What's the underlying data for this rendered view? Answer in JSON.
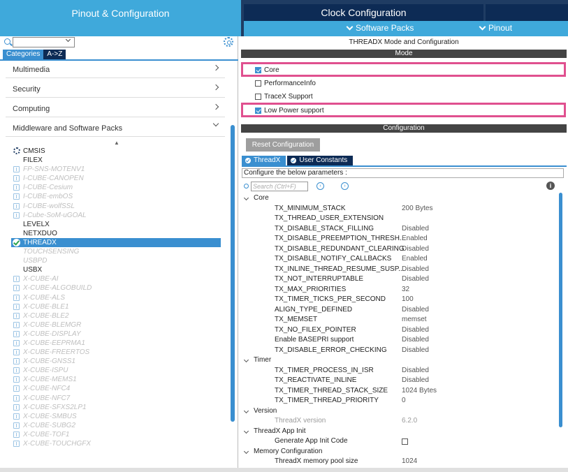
{
  "top_tabs": {
    "pinout_config": "Pinout & Configuration",
    "clock_config": "Clock Configuration"
  },
  "subnav": {
    "software_packs": "Software Packs",
    "pinout": "Pinout"
  },
  "left": {
    "search_value": "",
    "tabs": [
      "Categories",
      "A->Z"
    ],
    "categories": [
      "Multimedia",
      "Security",
      "Computing",
      "Middleware and Software Packs"
    ],
    "items": [
      {
        "label": "CMSIS",
        "state": "normal",
        "icon": "gear-icon"
      },
      {
        "label": "FILEX",
        "state": "normal",
        "icon": ""
      },
      {
        "label": "FP-SNS-MOTENV1",
        "state": "disabled",
        "icon": "package-icon"
      },
      {
        "label": "I-CUBE-CANOPEN",
        "state": "disabled",
        "icon": "package-icon"
      },
      {
        "label": "I-CUBE-Cesium",
        "state": "disabled",
        "icon": "package-icon"
      },
      {
        "label": "I-CUBE-embOS",
        "state": "disabled",
        "icon": "package-icon"
      },
      {
        "label": "I-CUBE-wolfSSL",
        "state": "disabled",
        "icon": "package-icon"
      },
      {
        "label": "I-Cube-SoM-uGOAL",
        "state": "disabled",
        "icon": "package-icon"
      },
      {
        "label": "LEVELX",
        "state": "normal",
        "icon": ""
      },
      {
        "label": "NETXDUO",
        "state": "normal",
        "icon": ""
      },
      {
        "label": "THREADX",
        "state": "selected",
        "icon": "check-circle-icon"
      },
      {
        "label": "TOUCHSENSING",
        "state": "disabled",
        "icon": ""
      },
      {
        "label": "USBPD",
        "state": "disabled",
        "icon": ""
      },
      {
        "label": "USBX",
        "state": "normal",
        "icon": ""
      },
      {
        "label": "X-CUBE-AI",
        "state": "disabled",
        "icon": "package-icon"
      },
      {
        "label": "X-CUBE-ALGOBUILD",
        "state": "disabled",
        "icon": "package-icon"
      },
      {
        "label": "X-CUBE-ALS",
        "state": "disabled",
        "icon": "package-icon"
      },
      {
        "label": "X-CUBE-BLE1",
        "state": "disabled",
        "icon": "package-icon"
      },
      {
        "label": "X-CUBE-BLE2",
        "state": "disabled",
        "icon": "package-icon"
      },
      {
        "label": "X-CUBE-BLEMGR",
        "state": "disabled",
        "icon": "package-icon"
      },
      {
        "label": "X-CUBE-DISPLAY",
        "state": "disabled",
        "icon": "package-icon"
      },
      {
        "label": "X-CUBE-EEPRMA1",
        "state": "disabled",
        "icon": "package-icon"
      },
      {
        "label": "X-CUBE-FREERTOS",
        "state": "disabled",
        "icon": "package-icon"
      },
      {
        "label": "X-CUBE-GNSS1",
        "state": "disabled",
        "icon": "package-icon"
      },
      {
        "label": "X-CUBE-ISPU",
        "state": "disabled",
        "icon": "package-icon"
      },
      {
        "label": "X-CUBE-MEMS1",
        "state": "disabled",
        "icon": "package-icon"
      },
      {
        "label": "X-CUBE-NFC4",
        "state": "disabled",
        "icon": "package-icon"
      },
      {
        "label": "X-CUBE-NFC7",
        "state": "disabled",
        "icon": "package-icon"
      },
      {
        "label": "X-CUBE-SFXS2LP1",
        "state": "disabled",
        "icon": "package-icon"
      },
      {
        "label": "X-CUBE-SMBUS",
        "state": "disabled",
        "icon": "package-icon"
      },
      {
        "label": "X-CUBE-SUBG2",
        "state": "disabled",
        "icon": "package-icon"
      },
      {
        "label": "X-CUBE-TOF1",
        "state": "disabled",
        "icon": "package-icon"
      },
      {
        "label": "X-CUBE-TOUCHGFX",
        "state": "disabled",
        "icon": "package-icon"
      }
    ]
  },
  "right": {
    "title": "THREADX Mode and Configuration",
    "mode_header": "Mode",
    "mode_options": [
      {
        "label": "Core",
        "checked": true,
        "highlighted": true
      },
      {
        "label": "PerformanceInfo",
        "checked": false,
        "highlighted": false
      },
      {
        "label": "TraceX Support",
        "checked": false,
        "highlighted": false
      },
      {
        "label": "Low Power support",
        "checked": true,
        "highlighted": true
      }
    ],
    "config_header": "Configuration",
    "reset_button": "Reset Configuration",
    "config_tabs": [
      "ThreadX",
      "User Constants"
    ],
    "param_caption": "Configure the below parameters :",
    "search_placeholder": "Search (Ctrl+F)",
    "tree": [
      {
        "type": "group",
        "label": "Core"
      },
      {
        "type": "param",
        "label": "TX_MINIMUM_STACK",
        "value": "200 Bytes"
      },
      {
        "type": "param",
        "label": "TX_THREAD_USER_EXTENSION",
        "value": ""
      },
      {
        "type": "param",
        "label": "TX_DISABLE_STACK_FILLING",
        "value": "Disabled"
      },
      {
        "type": "param",
        "label": "TX_DISABLE_PREEMPTION_THRESH...",
        "value": "Enabled"
      },
      {
        "type": "param",
        "label": "TX_DISABLE_REDUNDANT_CLEARING",
        "value": "Disabled"
      },
      {
        "type": "param",
        "label": "TX_DISABLE_NOTIFY_CALLBACKS",
        "value": "Enabled"
      },
      {
        "type": "param",
        "label": "TX_INLINE_THREAD_RESUME_SUSP...",
        "value": "Disabled"
      },
      {
        "type": "param",
        "label": "TX_NOT_INTERRUPTABLE",
        "value": "Disabled"
      },
      {
        "type": "param",
        "label": "TX_MAX_PRIORITIES",
        "value": "32"
      },
      {
        "type": "param",
        "label": "TX_TIMER_TICKS_PER_SECOND",
        "value": "100"
      },
      {
        "type": "param",
        "label": "ALIGN_TYPE_DEFINED",
        "value": "Disabled"
      },
      {
        "type": "param",
        "label": "TX_MEMSET",
        "value": "memset"
      },
      {
        "type": "param",
        "label": "TX_NO_FILEX_POINTER",
        "value": "Disabled"
      },
      {
        "type": "param",
        "label": "Enable BASEPRI support",
        "value": "Disabled"
      },
      {
        "type": "param",
        "label": "TX_DISABLE_ERROR_CHECKING",
        "value": "Disabled"
      },
      {
        "type": "group",
        "label": "Timer"
      },
      {
        "type": "param",
        "label": "TX_TIMER_PROCESS_IN_ISR",
        "value": "Disabled"
      },
      {
        "type": "param",
        "label": "TX_REACTIVATE_INLINE",
        "value": "Disabled"
      },
      {
        "type": "param",
        "label": "TX_TIMER_THREAD_STACK_SIZE",
        "value": "1024 Bytes"
      },
      {
        "type": "param",
        "label": "TX_TIMER_THREAD_PRIORITY",
        "value": "0"
      },
      {
        "type": "group",
        "label": "Version"
      },
      {
        "type": "param",
        "label": "ThreadX version",
        "value": "6.2.0",
        "readonly": true
      },
      {
        "type": "group",
        "label": "ThreadX App Init"
      },
      {
        "type": "param",
        "label": "Generate App Init Code",
        "value": "",
        "checkbox": true
      },
      {
        "type": "group",
        "label": "Memory Configuration"
      },
      {
        "type": "param",
        "label": "ThreadX memory pool size",
        "value": "1024"
      }
    ]
  }
}
